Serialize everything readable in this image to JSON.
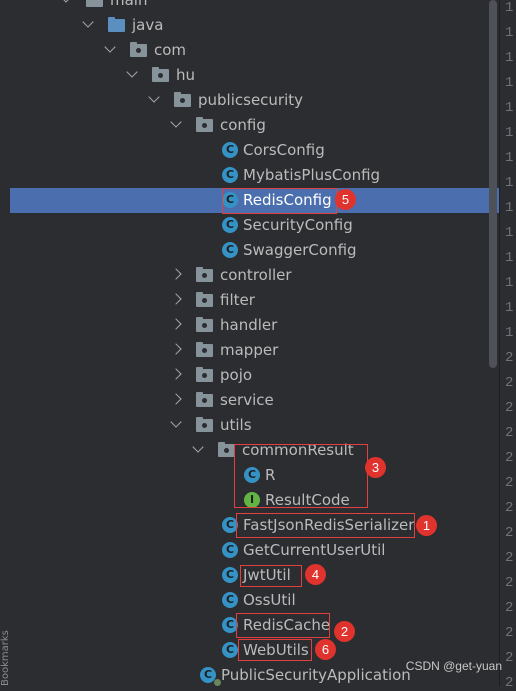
{
  "tree": {
    "rows": [
      {
        "label": "main",
        "kind": "folder",
        "arrow": "down"
      },
      {
        "label": "java",
        "kind": "java-folder",
        "arrow": "down"
      },
      {
        "label": "com",
        "kind": "package",
        "arrow": "down"
      },
      {
        "label": "hu",
        "kind": "package",
        "arrow": "down"
      },
      {
        "label": "publicsecurity",
        "kind": "package",
        "arrow": "down"
      },
      {
        "label": "config",
        "kind": "package",
        "arrow": "down"
      },
      {
        "label": "CorsConfig",
        "kind": "class"
      },
      {
        "label": "MybatisPlusConfig",
        "kind": "class"
      },
      {
        "label": "RedisConfig",
        "kind": "class",
        "selected": true
      },
      {
        "label": "SecurityConfig",
        "kind": "class"
      },
      {
        "label": "SwaggerConfig",
        "kind": "class"
      },
      {
        "label": "controller",
        "kind": "package",
        "arrow": "right"
      },
      {
        "label": "filter",
        "kind": "package",
        "arrow": "right"
      },
      {
        "label": "handler",
        "kind": "package",
        "arrow": "right"
      },
      {
        "label": "mapper",
        "kind": "package",
        "arrow": "right"
      },
      {
        "label": "pojo",
        "kind": "package",
        "arrow": "right"
      },
      {
        "label": "service",
        "kind": "package",
        "arrow": "right"
      },
      {
        "label": "utils",
        "kind": "package",
        "arrow": "down"
      },
      {
        "label": "commonResult",
        "kind": "package",
        "arrow": "down"
      },
      {
        "label": "R",
        "kind": "class"
      },
      {
        "label": "ResultCode",
        "kind": "interface"
      },
      {
        "label": "FastJsonRedisSerializer",
        "kind": "class"
      },
      {
        "label": "GetCurrentUserUtil",
        "kind": "class"
      },
      {
        "label": "JwtUtil",
        "kind": "class"
      },
      {
        "label": "OssUtil",
        "kind": "class"
      },
      {
        "label": "RedisCache",
        "kind": "class"
      },
      {
        "label": "WebUtils",
        "kind": "class"
      },
      {
        "label": "PublicSecurityApplication",
        "kind": "spring-class"
      }
    ]
  },
  "annotations": [
    "5",
    "3",
    "1",
    "4",
    "2",
    "6"
  ],
  "gutter_numbers": [
    "1",
    "1",
    "1",
    "1",
    "1",
    "1",
    "1",
    "1",
    "1",
    "1",
    "1",
    "1",
    "1",
    "1",
    "2",
    "2",
    "2",
    "2",
    "2",
    "2",
    "2",
    "2",
    "2",
    "2",
    "2",
    "2",
    "2",
    "2"
  ],
  "side_tab": "Bookmarks",
  "watermark": "CSDN @get-yuan",
  "colors": {
    "background": "#2b2d30",
    "selection": "#4b6eaf",
    "annotation": "#e0332d",
    "class_icon": "#3592c4",
    "interface_icon": "#62b543"
  }
}
